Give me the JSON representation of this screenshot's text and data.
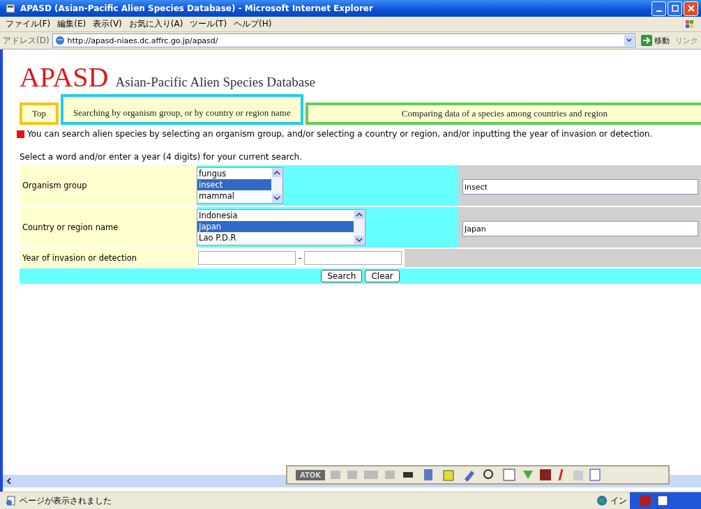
{
  "window": {
    "title": "APASD (Asian-Pacific Alien Species Database) - Microsoft Internet Explorer"
  },
  "menu": [
    "ファイル(F)",
    "編集(E)",
    "表示(V)",
    "お気に入り(A)",
    "ツール(T)",
    "ヘルプ(H)"
  ],
  "address_bar": {
    "label": "アドレス(D)",
    "url": "http://apasd-niaes.dc.affrc.go.jp/apasd/",
    "go": "移動",
    "links": "リンク"
  },
  "page": {
    "logo": "APASD",
    "subtitle": "Asian-Pacific Alien Species Database",
    "tabs": [
      {
        "label": "Top",
        "selected": false,
        "color": "#f5c518"
      },
      {
        "label": "Searching by organism group, or by country or region name",
        "selected": true,
        "color": "#22ccee"
      },
      {
        "label": "Comparing data of a species among countries and region",
        "selected": false,
        "color": "#66cc55"
      }
    ],
    "intro": "You can search alien species by selecting an organism group, and/or selecting a country or region, and/or inputting the year of invasion or detection.",
    "instruction": "Select a word and/or enter a year (4 digits) for your current search.",
    "form": [
      {
        "kind": "list",
        "label": "Organism group",
        "options": [
          {
            "text": "fungus",
            "selected": false
          },
          {
            "text": "insect",
            "selected": true
          },
          {
            "text": "mammal",
            "selected": false
          }
        ],
        "value": "insect"
      },
      {
        "kind": "list",
        "label": "Country or region name",
        "options": [
          {
            "text": "Indonesia",
            "selected": false
          },
          {
            "text": "Japan",
            "selected": true
          },
          {
            "text": "Lao P.D.R",
            "selected": false
          }
        ],
        "value": "Japan"
      },
      {
        "kind": "range",
        "label": "Year of invasion or detection",
        "separator": "-"
      }
    ],
    "buttons": [
      "Search",
      "Clear"
    ]
  },
  "ime_bar": {
    "label": "ATOK"
  },
  "status_bar": {
    "text": "ページが表示されました",
    "zone": "イン"
  }
}
